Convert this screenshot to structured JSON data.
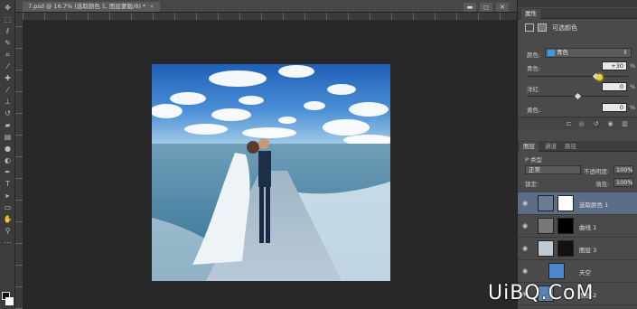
{
  "document": {
    "tab_title": "7.psd @ 16.7% (选取颜色 1, 图层蒙版/8) *",
    "close": "×"
  },
  "window_controls": [
    "▬",
    "◻",
    "✕"
  ],
  "toolbar": {
    "icons": [
      "move-icon",
      "marquee-icon",
      "lasso-icon",
      "quick-select-icon",
      "crop-icon",
      "eyedropper-icon",
      "healing-icon",
      "brush-icon",
      "stamp-icon",
      "history-brush-icon",
      "eraser-icon",
      "gradient-icon",
      "blur-icon",
      "dodge-icon",
      "pen-icon",
      "type-icon",
      "path-select-icon",
      "shape-icon",
      "hand-icon",
      "zoom-icon"
    ]
  },
  "properties": {
    "tabs": [
      "属性"
    ],
    "title": "可选颜色",
    "color_label": "颜色:",
    "color_value": "青色",
    "accent": "#3b9be0",
    "rows": [
      {
        "label": "青色:",
        "value": "+30",
        "unit": "%"
      },
      {
        "label": "洋红:",
        "value": "0",
        "unit": "%"
      },
      {
        "label": "黄色:",
        "value": "0",
        "unit": "%"
      }
    ]
  },
  "layers_panel": {
    "tabs": [
      "图层",
      "通道",
      "路径"
    ],
    "kind_label": "P 类型",
    "blend_mode": "正常",
    "opacity_label": "不透明度:",
    "opacity_value": "100%",
    "lock_label": "锁定:",
    "fill_label": "填充:",
    "fill_value": "100%",
    "layers": [
      {
        "name": "选取颜色 1",
        "selected": true
      },
      {
        "name": "曲线 1",
        "selected": false
      },
      {
        "name": "图层 3",
        "selected": false
      },
      {
        "name": "天空",
        "selected": false
      },
      {
        "name": "图层 2",
        "selected": false
      }
    ]
  },
  "watermark": "UiBQ.CoM"
}
